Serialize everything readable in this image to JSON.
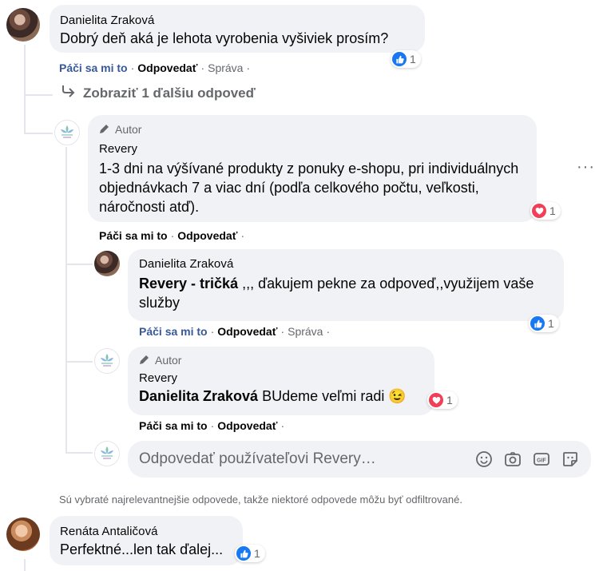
{
  "comment1": {
    "name": "Danielita Zraková",
    "text": "Dobrý deň aká je lehota vyrobenia vyšiviek prosím?",
    "reaction_count": "1",
    "actions": {
      "like": "Páči sa mi to",
      "reply": "Odpovedať",
      "edit": "Správa"
    }
  },
  "more_replies": {
    "label": "Zobraziť 1 ďalšiu odpoveď"
  },
  "reply1": {
    "author_badge": "Autor",
    "name": "Revery",
    "text": "1-3 dni na výšívané produkty z ponuky e-shopu, pri individuálnych objednávkach 7 a viac dní (podľa celkového počtu, veľkosti, náročnosti atď).",
    "reaction_count": "1",
    "actions": {
      "like": "Páči sa mi to",
      "reply": "Odpovedať"
    },
    "more_label": "···"
  },
  "reply2": {
    "name": "Danielita Zraková",
    "mention": "Revery - tričká",
    "text": " ,,, ďakujem pekne za odpoveď,,využijem vaše služby",
    "reaction_count": "1",
    "actions": {
      "like": "Páči sa mi to",
      "reply": "Odpovedať",
      "edit": "Správa"
    }
  },
  "reply3": {
    "author_badge": "Autor",
    "name": "Revery",
    "mention": "Danielita Zraková",
    "text": " BUdeme veľmi radi ",
    "emoji": "😉",
    "reaction_count": "1",
    "actions": {
      "like": "Páči sa mi to",
      "reply": "Odpovedať"
    }
  },
  "reply_input": {
    "placeholder": "Odpovedať používateľovi Revery…"
  },
  "notice": {
    "text": "Sú vybraté najrelevantnejšie odpovede, takže niektoré odpovede môžu byť odfiltrované."
  },
  "comment2": {
    "name": "Renáta Antaličová",
    "text": "Perfektné...len tak ďalej...",
    "reaction_count": "1"
  },
  "colors": {
    "link": "#385898",
    "like": "#1877f2",
    "love": "#f33e58",
    "bubble": "#f0f2f5",
    "muted": "#65676b"
  }
}
